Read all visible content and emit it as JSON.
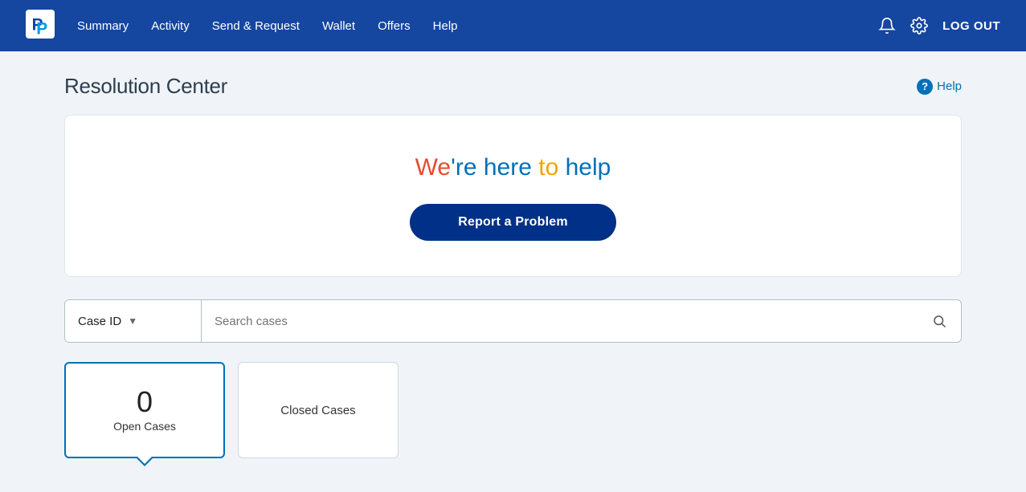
{
  "header": {
    "logo_alt": "PayPal",
    "nav": [
      {
        "label": "Summary",
        "id": "summary"
      },
      {
        "label": "Activity",
        "id": "activity"
      },
      {
        "label": "Send & Request",
        "id": "send-request"
      },
      {
        "label": "Wallet",
        "id": "wallet"
      },
      {
        "label": "Offers",
        "id": "offers"
      },
      {
        "label": "Help",
        "id": "help"
      }
    ],
    "logout_label": "LOG OUT"
  },
  "page": {
    "title": "Resolution Center",
    "help_label": "Help",
    "help_question": "?"
  },
  "hero": {
    "title_we": "We",
    "title_apostrophe": "'",
    "title_re": "re ",
    "title_here": "here ",
    "title_to": "to ",
    "title_help": "help",
    "full_title": "We're here to help",
    "report_button": "Report a Problem"
  },
  "search": {
    "dropdown_label": "Case ID",
    "placeholder": "Search cases"
  },
  "cases": {
    "open": {
      "count": "0",
      "label": "Open Cases"
    },
    "closed": {
      "label": "Closed Cases"
    }
  },
  "colors": {
    "header_bg": "#1546a0",
    "primary": "#0070ba",
    "dark_blue": "#003087",
    "accent_red": "#e44c30",
    "accent_yellow": "#f0a500"
  }
}
